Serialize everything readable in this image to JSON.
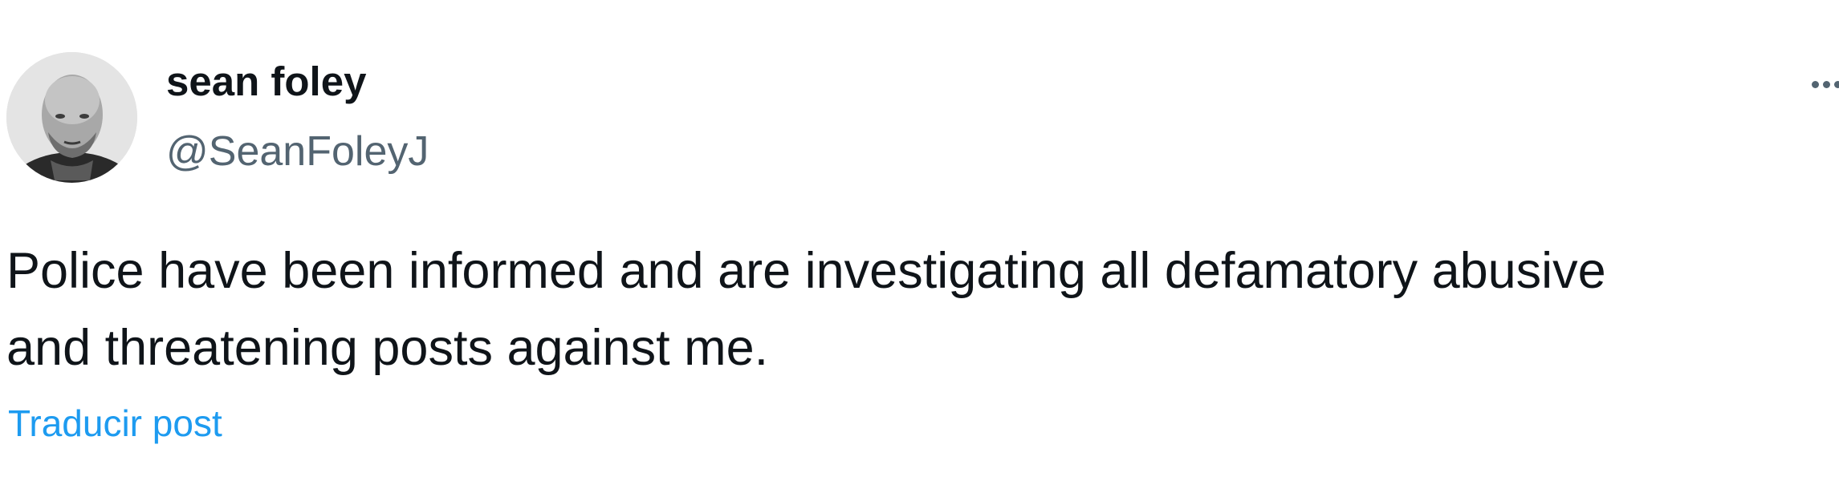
{
  "author": {
    "display_name": "sean foley",
    "handle": "@SeanFoleyJ",
    "avatar_icon": "profile-photo"
  },
  "post": {
    "text_lines": [
      "Police have been informed and are investigating all defamatory abusive",
      "and threatening posts against me."
    ],
    "translate_label": "Traducir post"
  },
  "actions": {
    "more_icon": "more-options-icon"
  },
  "colors": {
    "text_primary": "#0f1419",
    "text_secondary": "#536471",
    "link": "#1d9bf0"
  }
}
